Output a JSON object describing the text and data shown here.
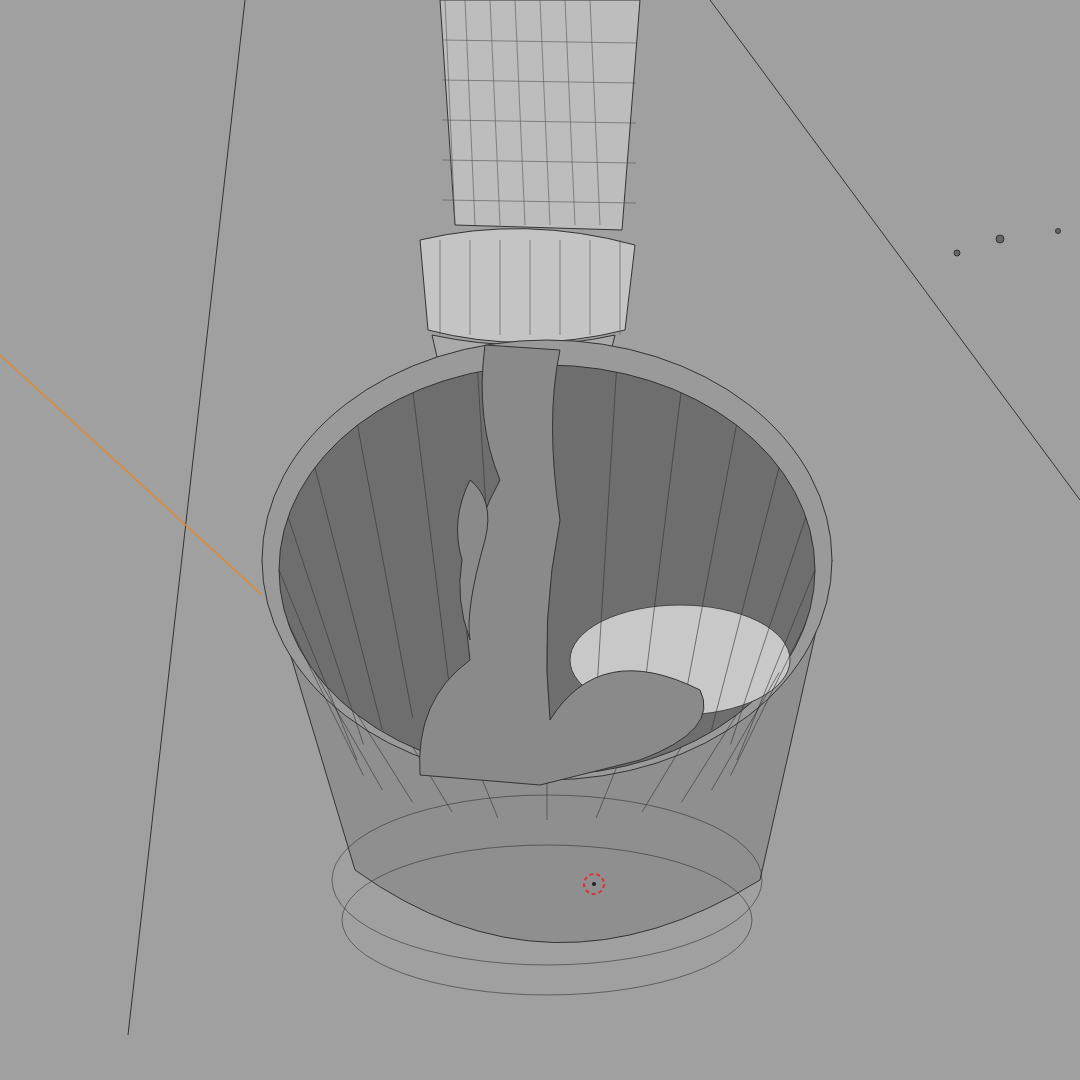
{
  "viewport": {
    "wireframe_overlay": true
  }
}
